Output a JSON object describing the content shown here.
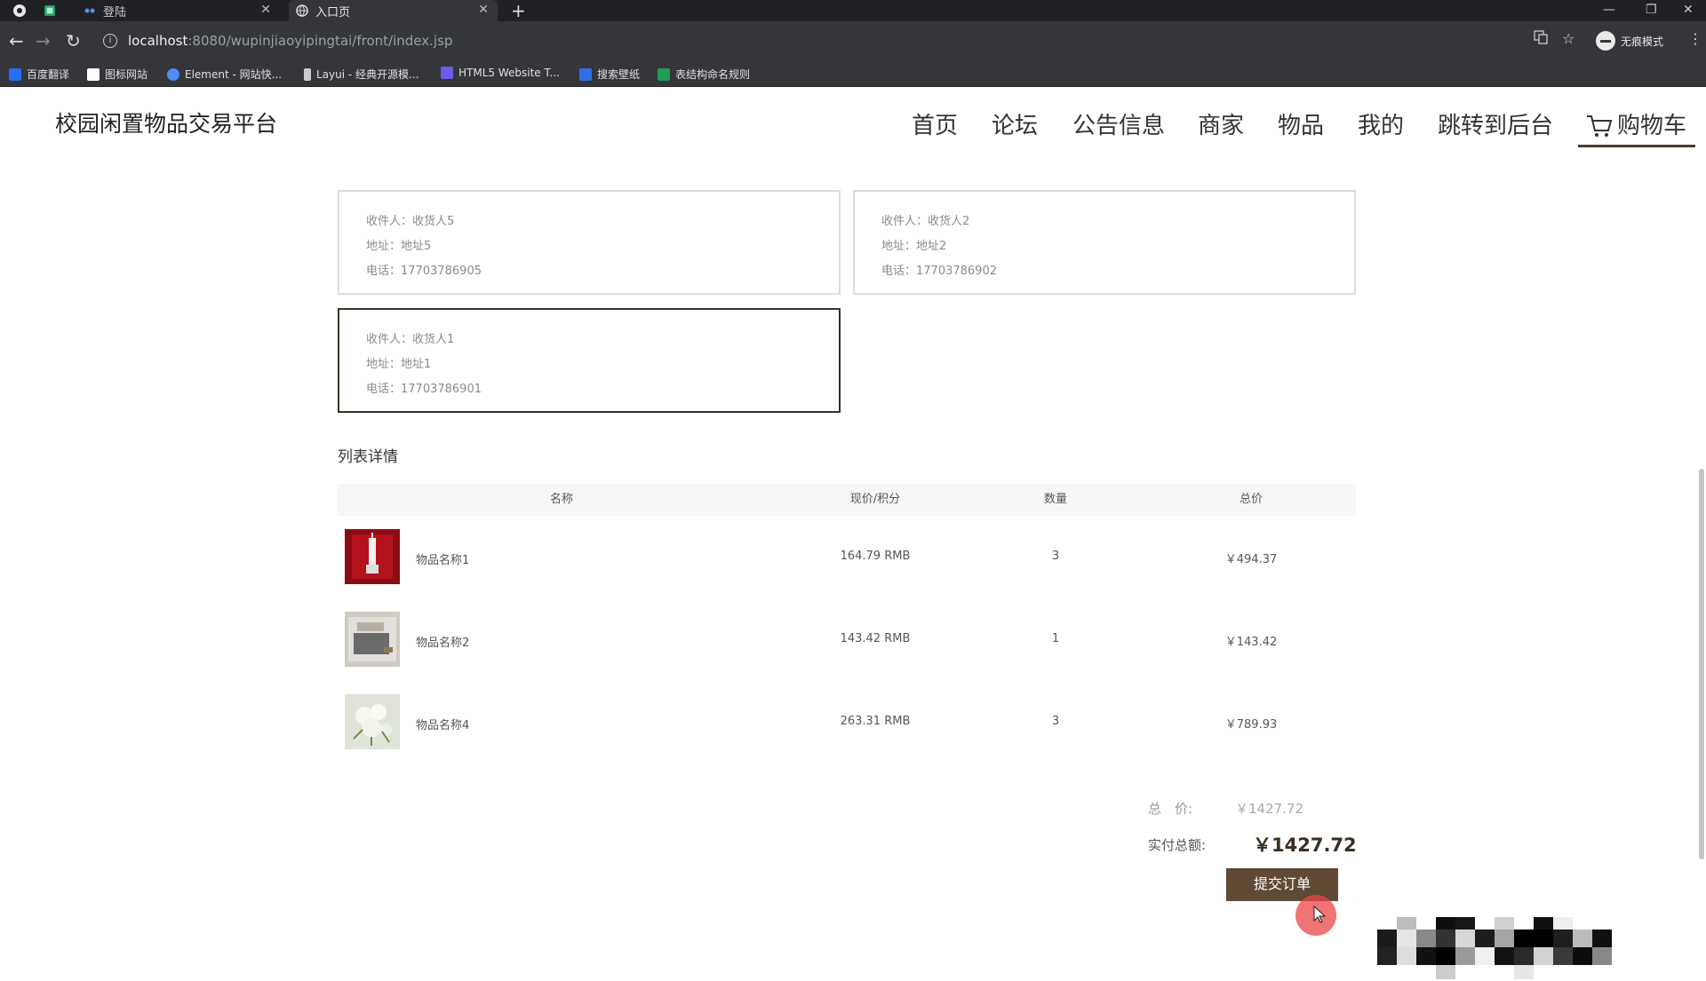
{
  "browser": {
    "tabs": [
      {
        "label": "",
        "icon": "spreadsheet-icon"
      },
      {
        "label": "登陆",
        "icon": "dots-icon"
      },
      {
        "label": "入口页",
        "icon": "globe-icon"
      }
    ],
    "url_host": "localhost",
    "url_path": ":8080/wupinjiaoyipingtai/front/index.jsp",
    "incognito_label": "无痕模式",
    "bookmarks": [
      {
        "label": "百度翻译",
        "color": "#2b6df2"
      },
      {
        "label": "图标网站",
        "color": "#ffffff"
      },
      {
        "label": "Element - 网站快...",
        "color": "#4e8cf7"
      },
      {
        "label": "Layui - 经典开源模...",
        "color": "#cccccc"
      },
      {
        "label": "HTML5 Website T...",
        "color": "#6c5ce7"
      },
      {
        "label": "搜索壁纸",
        "color": "#2f6ee6"
      },
      {
        "label": "表结构命名规则",
        "color": "#1f9d55"
      }
    ]
  },
  "site": {
    "title": "校园闲置物品交易平台",
    "nav": [
      "首页",
      "论坛",
      "公告信息",
      "商家",
      "物品",
      "我的",
      "跳转到后台",
      "购物车"
    ],
    "accent_color": "#5e4a35"
  },
  "addresses": [
    {
      "receiver": "收件人：收货人5",
      "address": "地址：地址5",
      "phone": "电话：17703786905",
      "selected": false
    },
    {
      "receiver": "收件人：收货人2",
      "address": "地址：地址2",
      "phone": "电话：17703786902",
      "selected": false
    },
    {
      "receiver": "收件人：收货人1",
      "address": "地址：地址1",
      "phone": "电话：17703786901",
      "selected": true
    }
  ],
  "list": {
    "title": "列表详情",
    "headers": [
      "名称",
      "现价/积分",
      "数量",
      "总价"
    ],
    "rows": [
      {
        "name": "物品名称1",
        "price": "164.79 RMB",
        "qty": "3",
        "total": "￥494.37"
      },
      {
        "name": "物品名称2",
        "price": "143.42 RMB",
        "qty": "1",
        "total": "￥143.42"
      },
      {
        "name": "物品名称4",
        "price": "263.31 RMB",
        "qty": "3",
        "total": "￥789.93"
      }
    ]
  },
  "summary": {
    "total_label": "总　价:",
    "total_value": "￥1427.72",
    "pay_label": "实付总额:",
    "pay_value": "￥1427.72",
    "submit_label": "提交订单"
  }
}
